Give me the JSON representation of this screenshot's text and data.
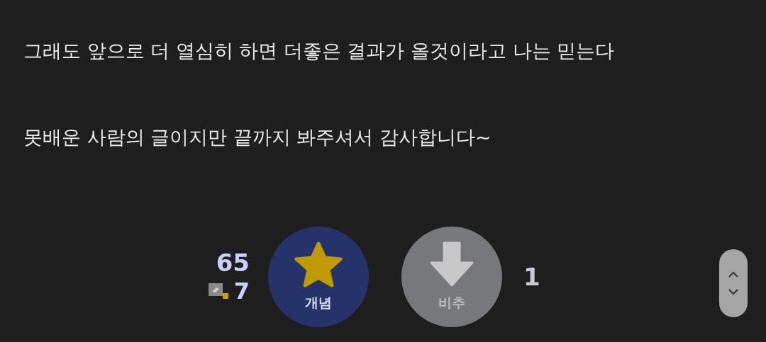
{
  "paragraphs": [
    "그래도 앞으로 더 열심히 하면 더좋은 결과가 올것이라고 나는 믿는다",
    "못배운 사람의 글이지만 끝까지 봐주셔서 감사합니다~"
  ],
  "votes": {
    "up_count": "65",
    "fixed_count": "7",
    "up_label": "개념",
    "down_label": "비추",
    "down_count": "1"
  }
}
